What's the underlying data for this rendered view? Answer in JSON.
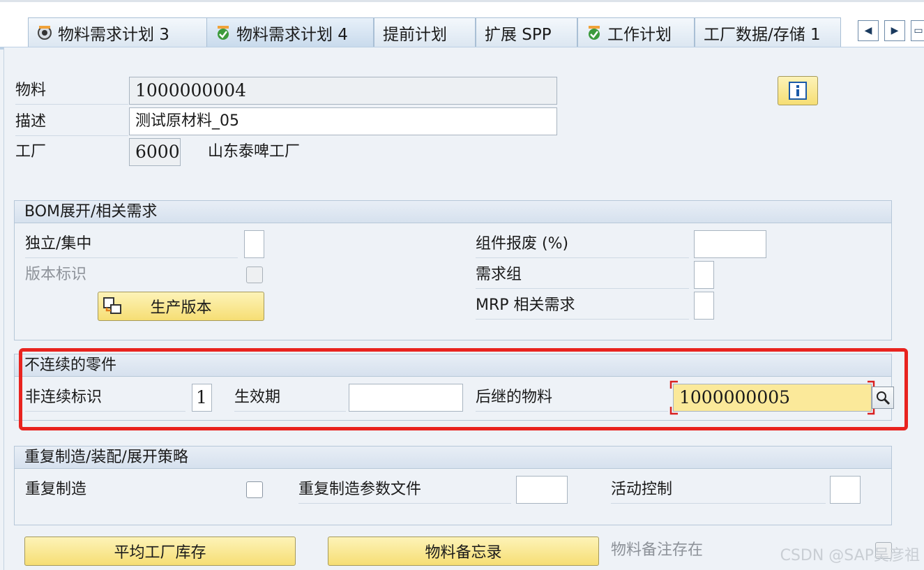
{
  "tabs": [
    {
      "label": "物料需求计划 3",
      "icon": "gear-icon"
    },
    {
      "label": "物料需求计划 4",
      "icon": "check-icon"
    },
    {
      "label": "提前计划",
      "icon": ""
    },
    {
      "label": "扩展 SPP",
      "icon": ""
    },
    {
      "label": "工作计划",
      "icon": "check-icon"
    },
    {
      "label": "工厂数据/存储 1",
      "icon": ""
    }
  ],
  "header": {
    "material_label": "物料",
    "material_value": "1000000004",
    "desc_label": "描述",
    "desc_value": "测试原材料_05",
    "plant_label": "工厂",
    "plant_value": "6000",
    "plant_name": "山东泰啤工厂"
  },
  "bom_group": {
    "title": "BOM展开/相关需求",
    "indiv_coll_label": "独立/集中",
    "version_ind_label": "版本标识",
    "prod_version_button": "生产版本",
    "component_scrap_label": "组件报废 (%)",
    "req_group_label": "需求组",
    "mrp_dep_req_label": "MRP 相关需求"
  },
  "discontinued_group": {
    "title": "不连续的零件",
    "disc_ind_label": "非连续标识",
    "disc_ind_value": "1",
    "eff_date_label": "生效期",
    "follow_up_label": "后继的物料",
    "follow_up_value": "1000000005"
  },
  "repetitive_group": {
    "title": "重复制造/装配/展开策略",
    "rep_mfg_label": "重复制造",
    "rep_profile_label": "重复制造参数文件",
    "action_control_label": "活动控制"
  },
  "footer": {
    "avg_stock_button": "平均工厂库存",
    "memo_button": "物料备忘录",
    "memo_exists_label": "物料备注存在"
  },
  "watermark": "CSDN @SAP吴彦祖",
  "colors": {
    "highlight": "#e8231f",
    "button": "#f6de74"
  }
}
